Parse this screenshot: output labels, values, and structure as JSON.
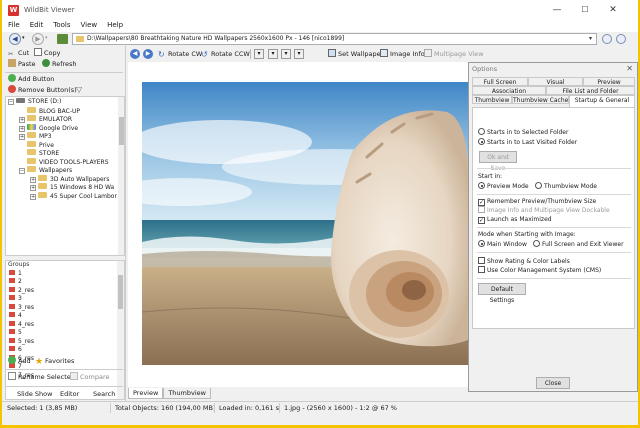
{
  "window": {
    "title": "WildBit Viewer",
    "logo": "W",
    "controls": [
      "—",
      "☐",
      "✕"
    ]
  },
  "menu": [
    "File",
    "Edit",
    "Tools",
    "View",
    "Help"
  ],
  "address": {
    "path": "D:\\Wallpapers\\80 Breathtaking Nature HD Wallpapers 2560x1600 Px - 146 [nico1899]"
  },
  "left_toolbar": {
    "cut": "Cut",
    "copy": "Copy",
    "paste": "Paste",
    "refresh": "Refresh",
    "add_button": "Add Button",
    "remove_buttons": "Remove Button(s)"
  },
  "tree": [
    {
      "label": "STORE (D:)",
      "level": 0,
      "expander": "−",
      "icon": "drive"
    },
    {
      "label": "BLOG BAC-UP",
      "level": 1,
      "expander": "",
      "icon": "folder"
    },
    {
      "label": "EMULATOR",
      "level": 1,
      "expander": "+",
      "icon": "folder"
    },
    {
      "label": "Google Drive",
      "level": 1,
      "expander": "+",
      "icon": "gdrive"
    },
    {
      "label": "MP3",
      "level": 1,
      "expander": "+",
      "icon": "folder"
    },
    {
      "label": "Prive",
      "level": 1,
      "expander": "",
      "icon": "folder"
    },
    {
      "label": "STORE",
      "level": 1,
      "expander": "",
      "icon": "folder"
    },
    {
      "label": "VIDEO TOOLS-PLAYERS",
      "level": 1,
      "expander": "",
      "icon": "folder"
    },
    {
      "label": "Wallpapers",
      "level": 1,
      "expander": "−",
      "icon": "folder"
    },
    {
      "label": "3D Auto Wallpapers",
      "level": 2,
      "expander": "+",
      "icon": "folder"
    },
    {
      "label": "15 Windows 8 HD Wa",
      "level": 2,
      "expander": "+",
      "icon": "folder"
    },
    {
      "label": "45 Super Cool Lambor",
      "level": 2,
      "expander": "+",
      "icon": "folder"
    }
  ],
  "groups": {
    "header": "Groups",
    "items": [
      "1",
      "2",
      "2_res",
      "3",
      "3_res",
      "4",
      "4_res",
      "5",
      "5_res",
      "6",
      "6_res",
      "7",
      "7_res"
    ]
  },
  "left_bottom": {
    "add": "Add",
    "favorites": "Favorites",
    "rename_selected": "Rename Selected",
    "compare": "Compare",
    "tabs": [
      "Slide Show",
      "Editor",
      "Search"
    ]
  },
  "viewer_toolbar": {
    "rotate_cw": "Rotate CW",
    "rotate_ccw": "Rotate CCW",
    "set_wallpaper": "Set Wallpaper",
    "image_info": "Image Info",
    "multipage_view": "Multipage View"
  },
  "viewer_tabs": [
    "Preview",
    "Thumbview"
  ],
  "options": {
    "title": "Options",
    "tabs_row1": [
      "Full Screen",
      "Visual",
      "Preview"
    ],
    "tabs_row2": [
      "Association",
      "File List and Folder"
    ],
    "tabs_row3": [
      "Thumbview",
      "Thumbview Cache",
      "Startup & General"
    ],
    "starts_selected": "Starts in to Selected Folder",
    "starts_last": "Starts in to Last Visited Folder",
    "ok_save": "Ok and Save",
    "start_in_label": "Start in:",
    "preview_mode": "Preview Mode",
    "thumbview_mode": "Thumbview Mode",
    "remember_preview": "Remember Preview/Thumbview Size",
    "image_info_dockable": "Image Info and Multipage View Dockable",
    "launch_maximized": "Launch as Maximized",
    "mode_when_starting": "Mode when Starting with Image:",
    "main_window": "Main Window",
    "fullscreen_exit": "Full Screen and Exit Viewer",
    "show_rating": "Show Rating & Color Labels",
    "use_color_mgmt": "Use Color Management System (CMS)",
    "default_settings": "Default Settings",
    "close": "Close"
  },
  "status": {
    "selected": "Selected: 1 (3,85 MB)",
    "total": "Total Objects: 160 (194,00 MB)",
    "loaded": "Loaded in:  0,161 s",
    "info": "1.jpg  -  (2560 x 1600) - 1:2 @ 67  %"
  },
  "colors": {
    "accent_border": "#f5c400",
    "logo_bg": "#d9322d"
  }
}
